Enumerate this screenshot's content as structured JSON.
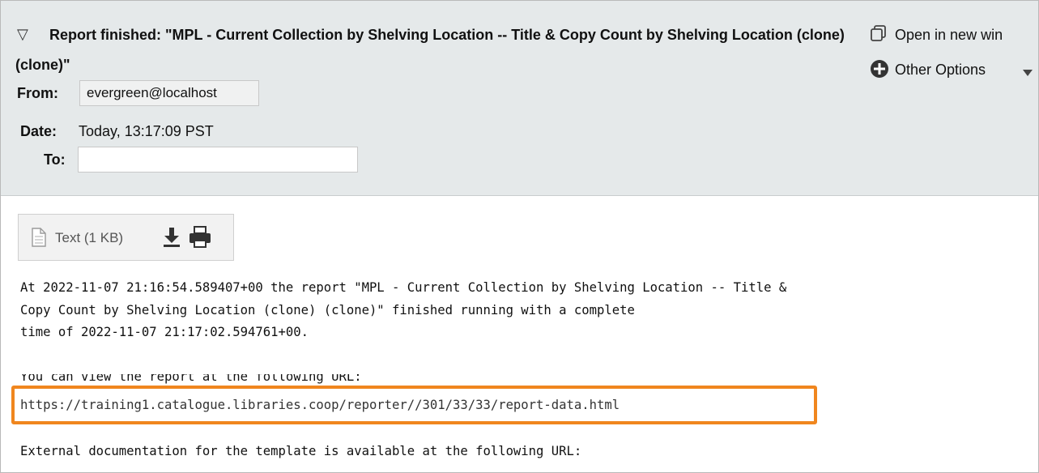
{
  "header": {
    "subject": "Report finished: \"MPL - Current Collection by Shelving Location -- Title & Copy Count by Shelving Location (clone) (clone)\"",
    "from_label": "From:",
    "from_value": "evergreen@localhost",
    "date_label": "Date:",
    "date_value": "Today, 13:17:09 PST",
    "to_label": "To:",
    "to_value": "",
    "open_new_window": "Open in new win",
    "other_options": "Other Options"
  },
  "attachment": {
    "label": "Text (1 KB)"
  },
  "body": {
    "line1": "At 2022-11-07 21:16:54.589407+00 the report \"MPL - Current Collection by Shelving Location -- Title &",
    "line2": "Copy Count by Shelving Location (clone) (clone)\" finished running with a complete",
    "line3": "time of 2022-11-07 21:17:02.594761+00.",
    "line4": "You can view the report at the following URL:",
    "url": "https://training1.catalogue.libraries.coop/reporter//301/33/33/report-data.html",
    "line6": "External documentation for the template is available at the following URL:"
  },
  "colors": {
    "header_bg": "#e5e9ea",
    "highlight": "#f0861e"
  }
}
